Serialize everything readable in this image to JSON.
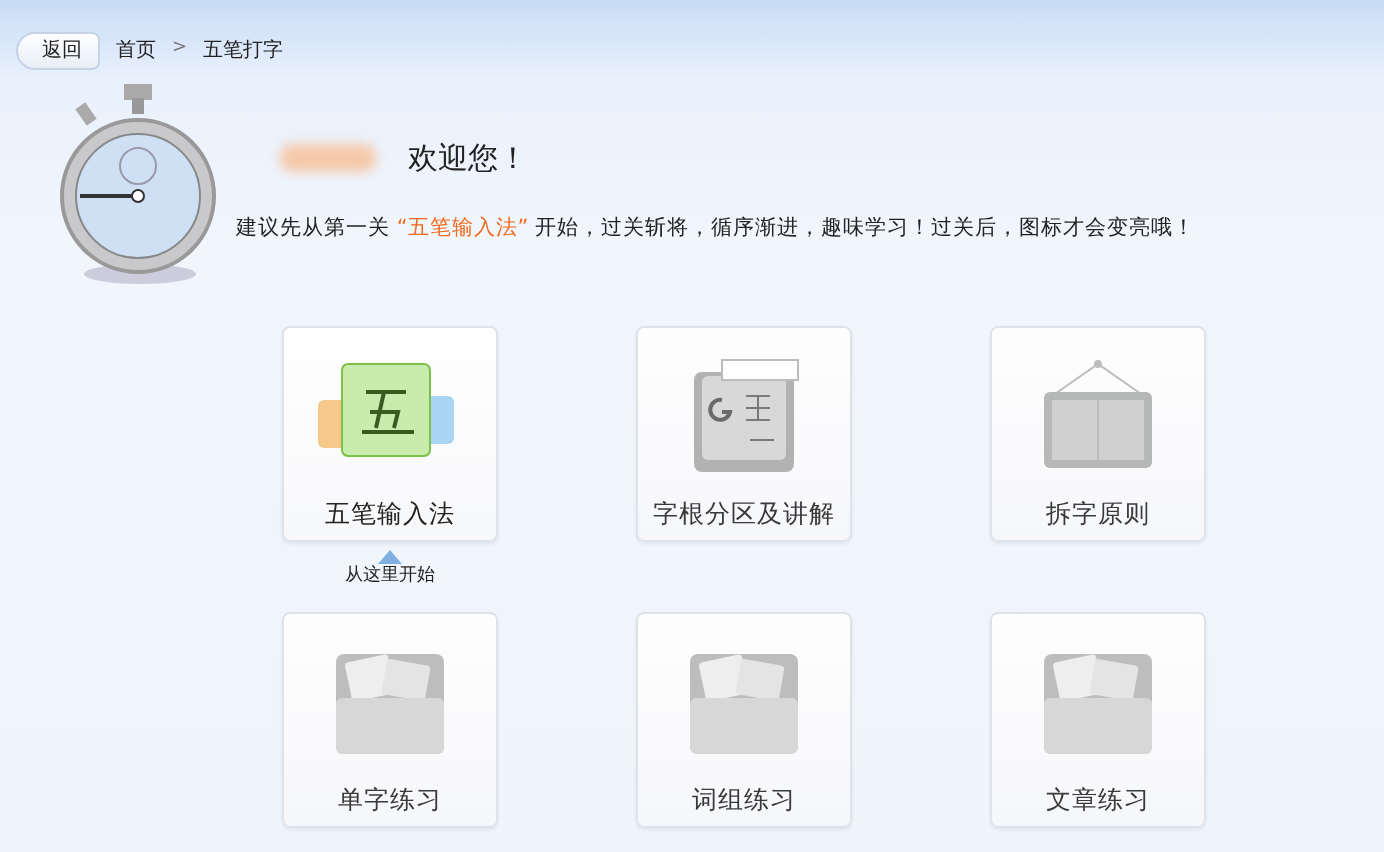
{
  "breadcrumb": {
    "back_button": "返回",
    "items": [
      "首页",
      "五笔打字"
    ],
    "separator": ">"
  },
  "welcome": {
    "greeting": "欢迎您！",
    "hint": "建议先从第一关 **“五笔输入法”** 开始，过关斩将，循序渐进，趣味学习！过关后，图标才会变亮哦！"
  },
  "lessons": [
    {
      "label": "五笔输入法",
      "kind": "input-method",
      "unlocked": true,
      "start_hint": "从这里开始"
    },
    {
      "label": "字根分区及讲解",
      "kind": "keyboard",
      "unlocked": false
    },
    {
      "label": "拆字原则",
      "kind": "board",
      "unlocked": false
    },
    {
      "label": "单字练习",
      "kind": "folder-single",
      "unlocked": false
    },
    {
      "label": "词组练习",
      "kind": "folder-phrase",
      "unlocked": false
    },
    {
      "label": "文章练习",
      "kind": "folder-article",
      "unlocked": false
    }
  ]
}
